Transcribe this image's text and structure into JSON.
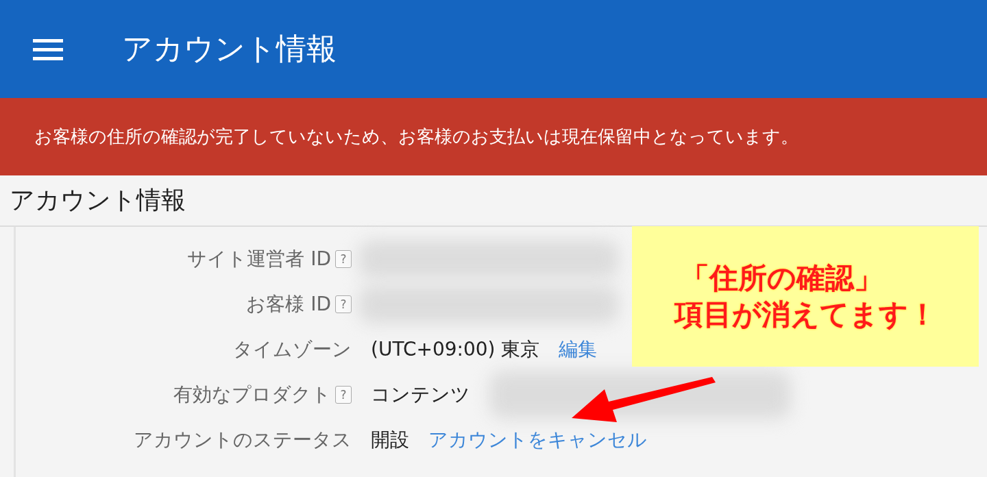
{
  "app_bar": {
    "title": "アカウント情報"
  },
  "alert": {
    "message": "お客様の住所の確認が完了していないため、お客様のお支払いは現在保留中となっています。"
  },
  "section": {
    "title": "アカウント情報"
  },
  "rows": [
    {
      "label": "サイト運営者 ID",
      "help": "?",
      "redacted": true
    },
    {
      "label": "お客様 ID",
      "help": "?",
      "redacted": true
    },
    {
      "label": "タイムゾーン",
      "value": "(UTC+09:00) 東京",
      "link": "編集",
      "redacted": false
    },
    {
      "label": "有効なプロダクト",
      "help": "?",
      "value": "コンテンツ",
      "redacted": true
    },
    {
      "label": "アカウントのステータス",
      "value": "開設",
      "link": "アカウントをキャンセル",
      "redacted": false
    }
  ],
  "annotation": {
    "lines": [
      "「住所の確認」",
      "項目が消えてます！"
    ]
  }
}
